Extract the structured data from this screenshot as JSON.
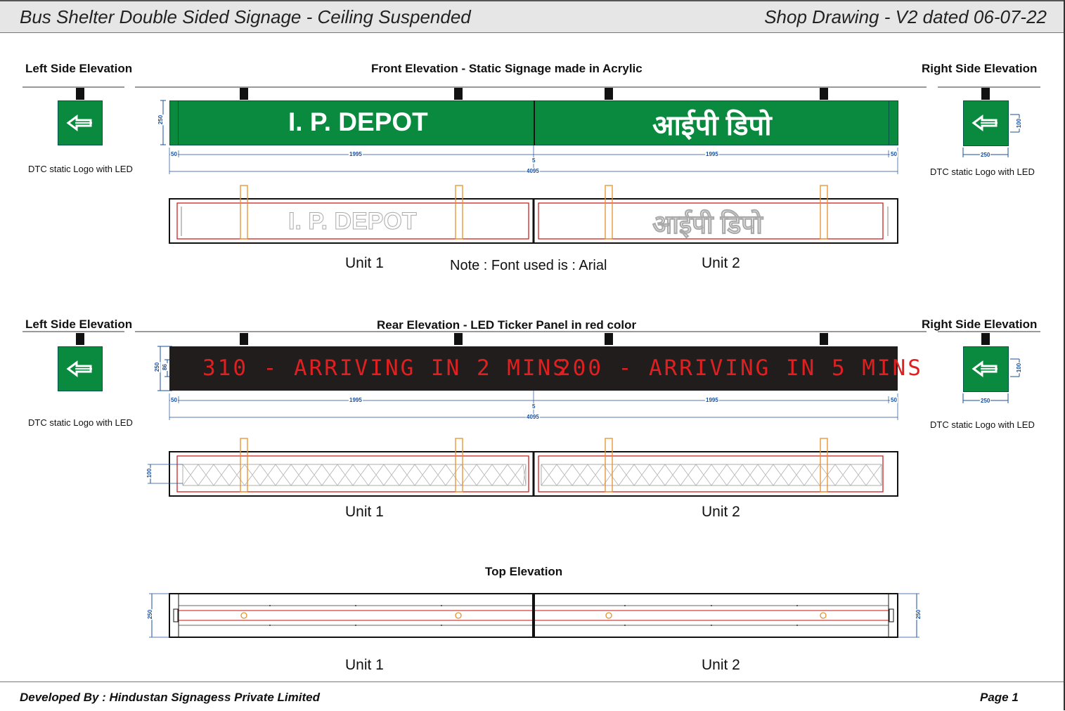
{
  "header": {
    "title": "Bus Shelter Double Sided Signage - Ceiling Suspended",
    "revision": "Shop Drawing - V2 dated 06-07-22"
  },
  "front_section": {
    "left_label": "Left Side Elevation",
    "center_label": "Front Elevation - Static Signage made in Acrylic",
    "right_label": "Right Side Elevation",
    "logo_caption_left": "DTC static Logo with LED",
    "logo_caption_right": "DTC static Logo with LED",
    "sign_text_en": "I. P. DEPOT",
    "sign_text_hi": "आईपी डिपो",
    "dim_height": "250",
    "dim_edge_left": "50",
    "dim_unit1": "1995",
    "dim_center": "5",
    "dim_unit2": "1995",
    "dim_edge_right": "50",
    "dim_total": "4095",
    "right_dim_height": "100",
    "right_dim_width": "250",
    "unit1_label": "Unit 1",
    "unit2_label": "Unit 2",
    "note": "Note : Font used is : Arial"
  },
  "rear_section": {
    "left_label": "Left Side Elevation",
    "center_label": "Rear Elevation - LED Ticker Panel in red color",
    "right_label": "Right Side Elevation",
    "logo_caption_left": "DTC static Logo with LED",
    "logo_caption_right": "DTC static Logo with LED",
    "ticker_1": "310 -  ARRIVING IN 2 MINS",
    "ticker_2": "200 -  ARRIVING IN 5 MINS",
    "dim_height": "250",
    "dim_inner": "86",
    "dim_edge_left": "50",
    "dim_unit1": "1995",
    "dim_center": "5",
    "dim_unit2": "1995",
    "dim_edge_right": "50",
    "dim_total": "4095",
    "dim_section": "100",
    "right_dim_height": "100",
    "right_dim_width": "250",
    "unit1_label": "Unit 1",
    "unit2_label": "Unit 2"
  },
  "top_section": {
    "label": "Top Elevation",
    "dim_left": "250",
    "dim_right": "250",
    "unit1_label": "Unit 1",
    "unit2_label": "Unit 2"
  },
  "footer": {
    "developer": "Developed By : Hindustan Signagess Private Limited",
    "page": "Page 1"
  },
  "colors": {
    "sign_green": "#0a8a3e",
    "led_red": "#e02020",
    "led_background": "#211d1d",
    "dimension_blue": "#1a4f9c",
    "bracket_orange": "#e8902a"
  },
  "icons": [
    "dtc-logo-icon",
    "ceiling-mount-icon"
  ]
}
